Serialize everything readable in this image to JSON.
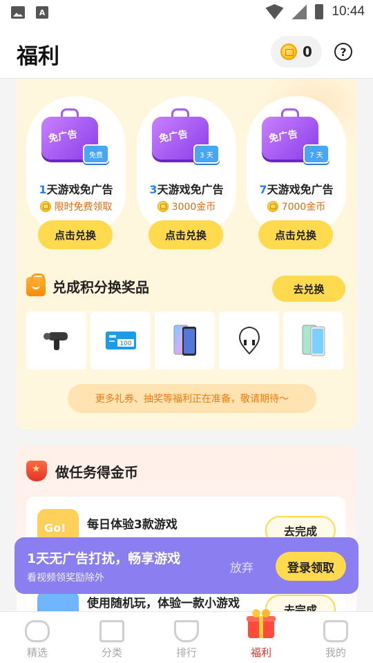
{
  "status_bar": {
    "time": "10:44"
  },
  "header": {
    "title": "福利",
    "coin_count": "0",
    "help_symbol": "?"
  },
  "ad_free": {
    "cards": [
      {
        "num": "1",
        "title_suffix": "天游戏免广告",
        "price": "限时免费领取",
        "tv_label": "免广告",
        "tag": "免费",
        "button": "点击兑换"
      },
      {
        "num": "3",
        "title_suffix": "天游戏免广告",
        "price": "3000金币",
        "tv_label": "免广告",
        "tag": "3 天",
        "button": "点击兑换"
      },
      {
        "num": "7",
        "title_suffix": "天游戏免广告",
        "price": "7000金币",
        "tv_label": "免广告",
        "tag": "7 天",
        "button": "点击兑换"
      }
    ]
  },
  "prizes": {
    "title": "兑成积分换奖品",
    "button": "去兑换",
    "items": [
      "massage-gun",
      "phone-card-100",
      "smartphone-gradient",
      "neck-earphones",
      "smartphone-green"
    ],
    "card_text": "100"
  },
  "notice": "更多礼券、抽奖等福利正在准备，敬请期待～",
  "tasks": {
    "title": "做任务得金币",
    "items": [
      {
        "name": "每日体验3款游戏",
        "button": "去完成",
        "icon_text": "Go!"
      },
      {
        "name": "使用随机玩，体验一款小游戏",
        "button": "去完成"
      }
    ]
  },
  "toast": {
    "title": "1天无广告打扰，畅享游戏",
    "subtitle": "看视频领奖励除外",
    "dismiss": "放弃",
    "action": "登录领取"
  },
  "bottom_nav": [
    {
      "label": "精选",
      "icon": "gamepad-icon"
    },
    {
      "label": "分类",
      "icon": "folder-icon"
    },
    {
      "label": "排行",
      "icon": "trophy-icon"
    },
    {
      "label": "福利",
      "icon": "gift-icon",
      "active": true
    },
    {
      "label": "我的",
      "icon": "profile-icon"
    }
  ],
  "colors": {
    "accent_yellow": "#ffd94e",
    "active_red": "#e0352b",
    "toast_purple": "#8b7ef0",
    "link_blue": "#2a7cf5"
  }
}
